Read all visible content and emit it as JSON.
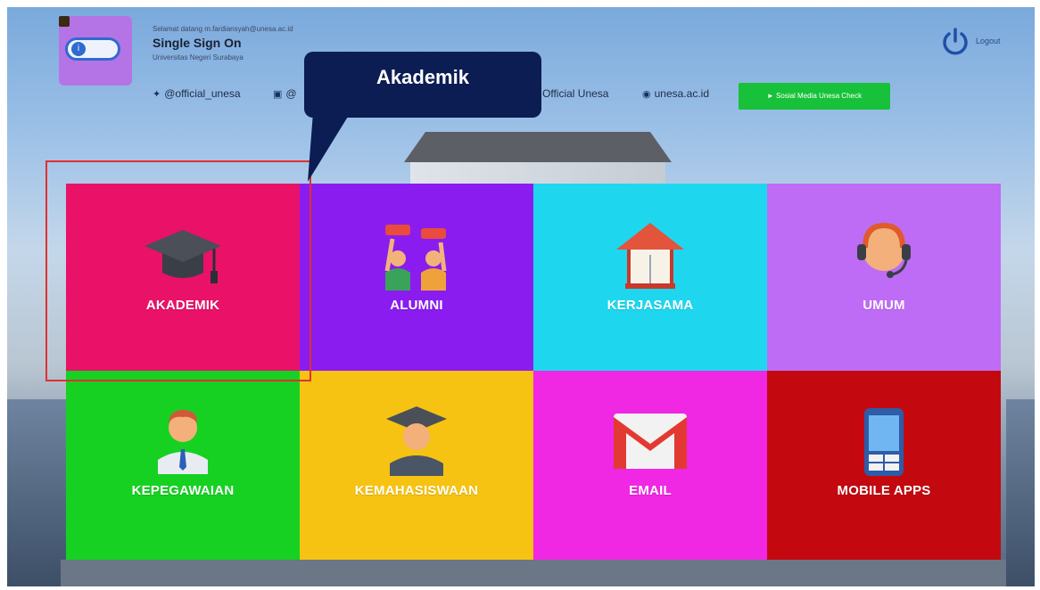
{
  "header": {
    "welcome_text": "Selamat datang m.fardiansyah@unesa.ac.id",
    "app_title": "Single Sign On",
    "university": "Universitas Negeri Surabaya",
    "logout_label": "Logout"
  },
  "social": {
    "twitter": "@official_unesa",
    "instagram": "@",
    "youtube": "Official Unesa",
    "website": "unesa.ac.id",
    "check_button": "Sosial Media Unesa Check"
  },
  "callout": {
    "text": "Akademik"
  },
  "tiles": [
    {
      "label": "AKADEMIK",
      "color": "#e91268",
      "icon": "graduation-cap-icon"
    },
    {
      "label": "ALUMNI",
      "color": "#8a1cf0",
      "icon": "alumni-cheer-icon"
    },
    {
      "label": "KERJASAMA",
      "color": "#1ed7ef",
      "icon": "book-house-icon"
    },
    {
      "label": "UMUM",
      "color": "#be6cf5",
      "icon": "customer-service-icon"
    },
    {
      "label": "KEPEGAWAIAN",
      "color": "#16d122",
      "icon": "employee-icon"
    },
    {
      "label": "KEMAHASISWAAN",
      "color": "#f6c312",
      "icon": "student-icon"
    },
    {
      "label": "EMAIL",
      "color": "#f027e3",
      "icon": "mail-icon"
    },
    {
      "label": "MOBILE APPS",
      "color": "#c4080f",
      "icon": "mobile-phone-icon"
    }
  ]
}
